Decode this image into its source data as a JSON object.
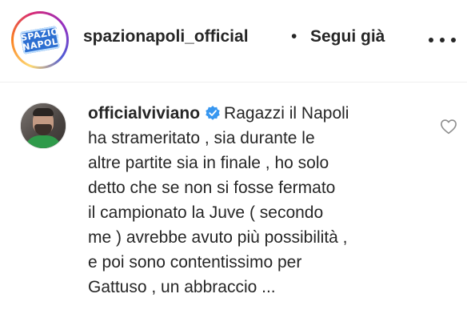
{
  "post_header": {
    "owner_username": "spazionapoli_official",
    "separator": "•",
    "follow_status": "Segui già",
    "avatar_logo": {
      "line1": "SPAZIO",
      "line2": "NAPOLI",
      "color": "#2d6fd1"
    },
    "more_icon": "more-horizontal-icon"
  },
  "comment": {
    "username": "officialviviano",
    "verified": true,
    "verified_icon": "verified-badge-icon",
    "verified_color": "#3897f0",
    "text_lines": [
      "Ragazzi il Napoli",
      "ha strameritato , sia durante le",
      "altre partite sia in finale , ho solo",
      "detto che se non si fosse fermato",
      "il campionato la Juve ( secondo",
      "me ) avrebbe avuto più possibilità ,",
      "e poi sono contentissimo per",
      "Gattuso , un abbraccio ..."
    ],
    "like_icon": "heart-outline-icon"
  }
}
